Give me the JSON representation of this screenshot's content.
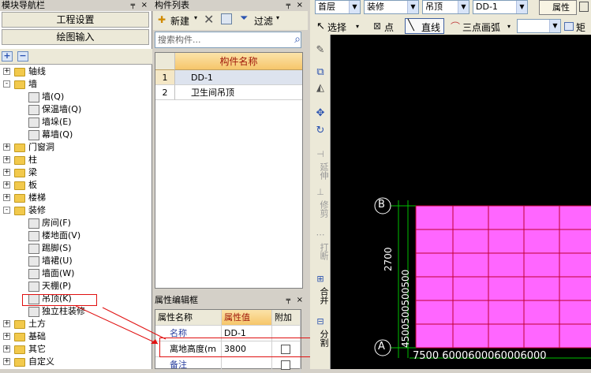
{
  "nav": {
    "title": "模块导航栏",
    "buttons": [
      "工程设置",
      "绘图输入"
    ],
    "tree": [
      {
        "label": "轴线",
        "kind": "folder",
        "exp": "+"
      },
      {
        "label": "墙",
        "kind": "folder",
        "exp": "-"
      },
      {
        "label": "墙(Q)",
        "kind": "leaf"
      },
      {
        "label": "保温墙(Q)",
        "kind": "leaf"
      },
      {
        "label": "墙垛(E)",
        "kind": "leaf"
      },
      {
        "label": "幕墙(Q)",
        "kind": "leaf"
      },
      {
        "label": "门窗洞",
        "kind": "folder",
        "exp": "+"
      },
      {
        "label": "柱",
        "kind": "folder",
        "exp": "+"
      },
      {
        "label": "梁",
        "kind": "folder",
        "exp": "+"
      },
      {
        "label": "板",
        "kind": "folder",
        "exp": "+"
      },
      {
        "label": "楼梯",
        "kind": "folder",
        "exp": "+"
      },
      {
        "label": "装修",
        "kind": "folder",
        "exp": "-"
      },
      {
        "label": "房间(F)",
        "kind": "leaf"
      },
      {
        "label": "楼地面(V)",
        "kind": "leaf"
      },
      {
        "label": "踢脚(S)",
        "kind": "leaf"
      },
      {
        "label": "墙裙(U)",
        "kind": "leaf"
      },
      {
        "label": "墙面(W)",
        "kind": "leaf"
      },
      {
        "label": "天棚(P)",
        "kind": "leaf"
      },
      {
        "label": "吊顶(K)",
        "kind": "leaf",
        "selected": true
      },
      {
        "label": "独立柱装修",
        "kind": "leaf"
      },
      {
        "label": "土方",
        "kind": "folder",
        "exp": "+"
      },
      {
        "label": "基础",
        "kind": "folder",
        "exp": "+"
      },
      {
        "label": "其它",
        "kind": "folder",
        "exp": "+"
      },
      {
        "label": "自定义",
        "kind": "folder",
        "exp": "+"
      }
    ]
  },
  "comp": {
    "title": "构件列表",
    "new_label": "新建",
    "filter_label": "过滤",
    "search_placeholder": "搜索构件...",
    "col_name": "构件名称",
    "rows": [
      {
        "n": "1",
        "name": "DD-1"
      },
      {
        "n": "2",
        "name": "卫生间吊顶"
      }
    ]
  },
  "prop": {
    "title": "属性编辑框",
    "col_name": "属性名称",
    "col_value": "属性值",
    "col_extra": "附加",
    "rows": [
      {
        "name": "名称",
        "value": "DD-1"
      },
      {
        "name": "离地高度(m",
        "value": "3800"
      },
      {
        "name": "备注",
        "value": ""
      }
    ]
  },
  "top": {
    "floor": "首层",
    "type": "装修",
    "sub": "吊顶",
    "item": "DD-1",
    "attr_label": "属性",
    "select_label": "选择",
    "point_label": "点",
    "line_label": "直线",
    "arc_label": "三点画弧",
    "rect_label": "矩"
  },
  "vtools": [
    "延伸",
    "修剪",
    "打断",
    "合并",
    "分割"
  ],
  "canvas": {
    "axis_b": "B",
    "axis_a": "A",
    "left_dim": "2700",
    "left_dims2": "4500500500500",
    "bottom_dim": "7500 6000600060006000",
    "accent": "#ff66ff"
  }
}
